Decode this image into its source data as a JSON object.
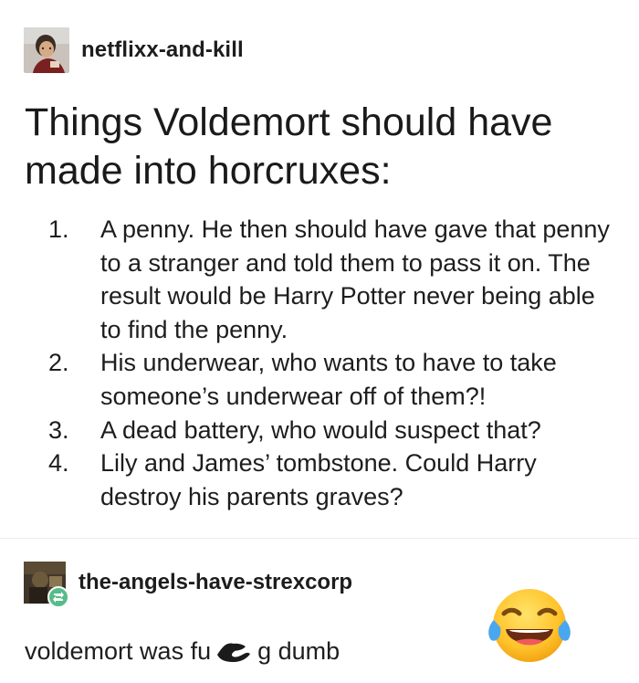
{
  "post": {
    "author": "netflixx-and-kill",
    "title": "Things Voldemort should have made into horcruxes:",
    "items": [
      {
        "number": "1.",
        "text": "A penny. He then should have gave that penny to a stranger and told them to pass it on. The result would be Harry Potter never being able to find the penny."
      },
      {
        "number": "2.",
        "text": "His underwear, who wants to have to take someone’s underwear off of them?!"
      },
      {
        "number": "3.",
        "text": "A dead battery, who would suspect that?"
      },
      {
        "number": "4.",
        "text": "Lily and James’ tombstone. Could Harry destroy his parents graves?"
      }
    ],
    "avatar_icon": "user-avatar-icon"
  },
  "reblog": {
    "author": "the-angels-have-strexcorp",
    "comment_before": "voldemort was fu",
    "comment_after": "g dumb",
    "avatar_icon": "user-avatar-icon",
    "badge_icon": "reblog-icon",
    "badge_color": "#56bc8a"
  },
  "overlay": {
    "emoji_icon": "laughing-tears-emoji-icon"
  }
}
